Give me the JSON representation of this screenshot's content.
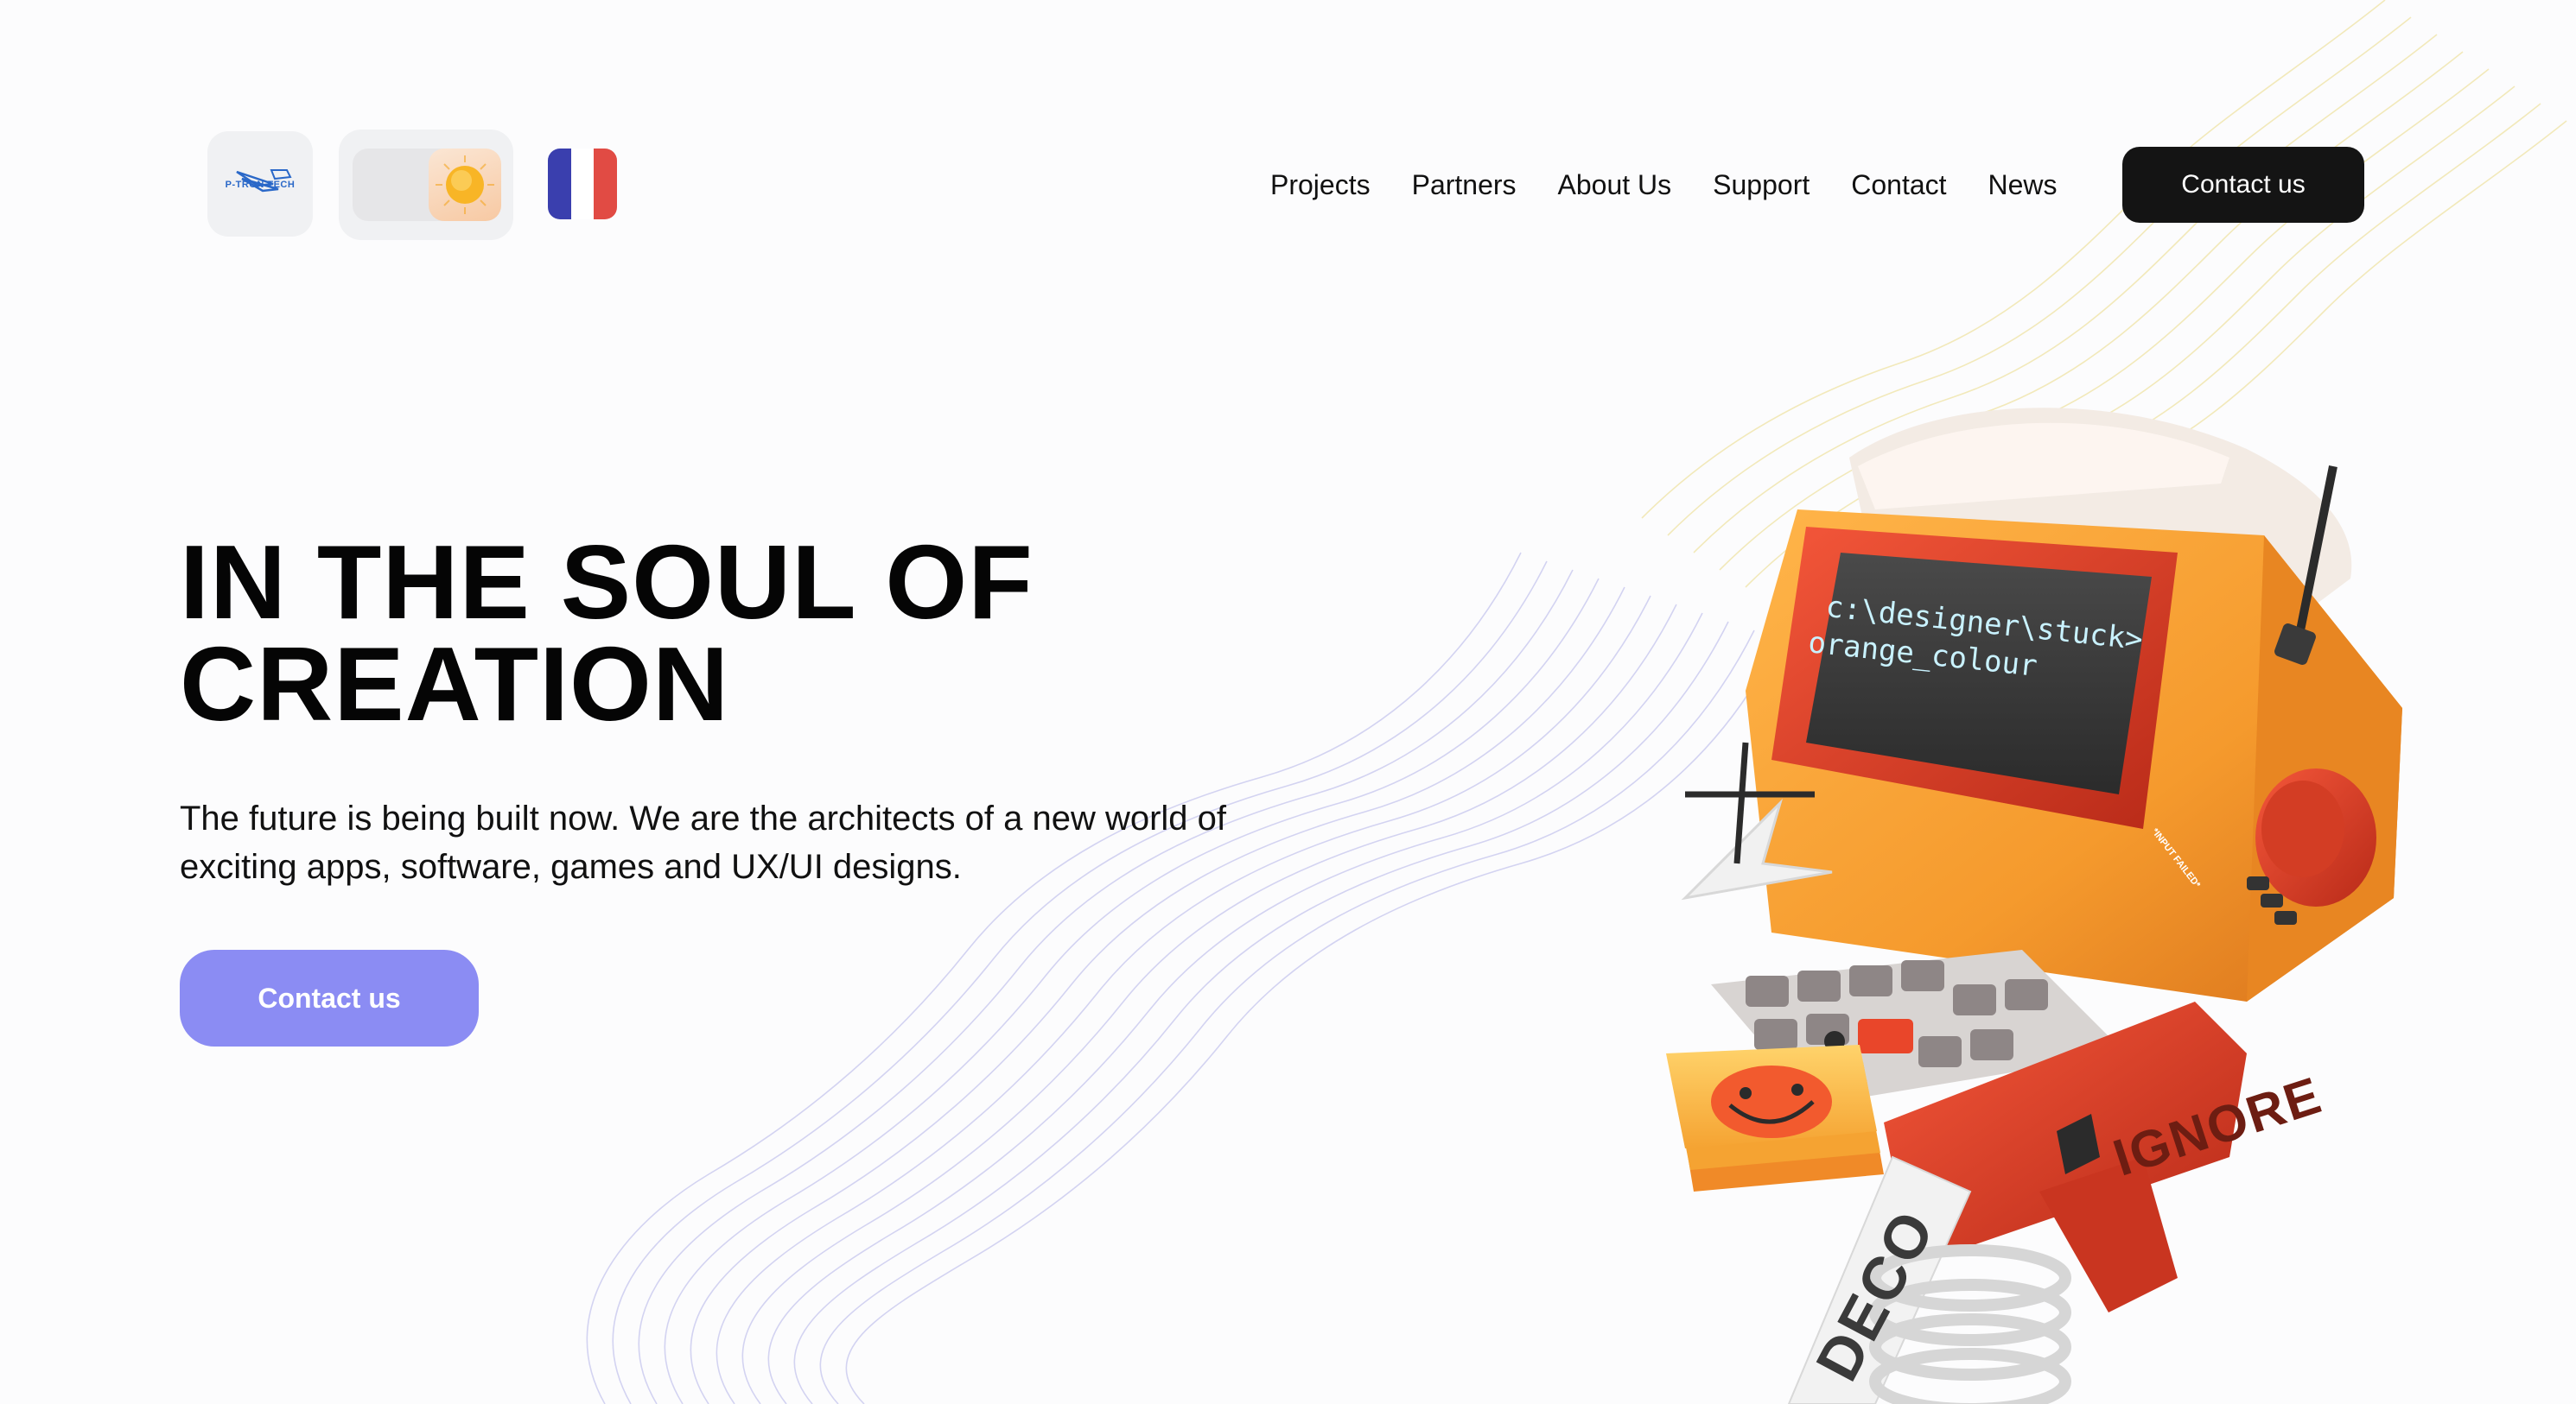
{
  "brand": {
    "logo_text": "P-TRON TECH",
    "accent": "#8b8cf3"
  },
  "header": {
    "theme_toggle": {
      "state": "light",
      "icon": "sun-icon"
    },
    "language": {
      "flag": "france-flag-icon"
    },
    "nav": [
      {
        "label": "Projects"
      },
      {
        "label": "Partners"
      },
      {
        "label": "About Us"
      },
      {
        "label": "Support"
      },
      {
        "label": "Contact"
      },
      {
        "label": "News"
      }
    ],
    "cta_label": "Contact us"
  },
  "hero": {
    "title_line1": "IN THE SOUL OF",
    "title_line2": "CREATION",
    "subtitle_line1": "The future is being built now. We are the architects of a new world of",
    "subtitle_line2": "exciting apps, software, games and UX/UI designs.",
    "cta_label": "Contact us"
  },
  "illustration": {
    "screen_line1": "c:\\designer\\stuck>",
    "screen_line2": "orange_colour",
    "sticker_text": "*INPUT FAILED*",
    "gun_text": "IGNORE",
    "tape_text": "DECO"
  }
}
